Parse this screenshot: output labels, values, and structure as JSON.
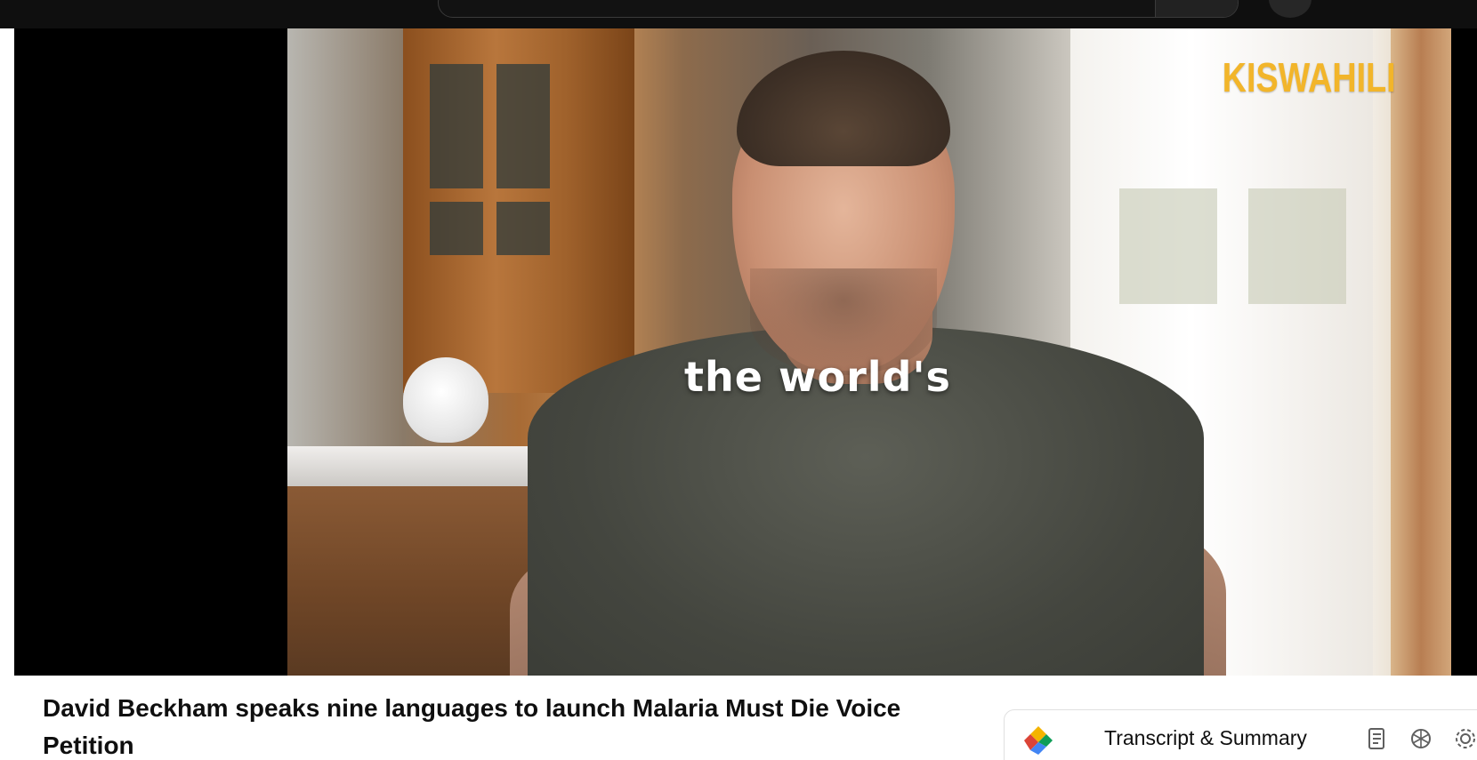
{
  "player": {
    "watermark": "KISWAHILI",
    "caption": "the world's"
  },
  "video": {
    "title": "David Beckham speaks nine languages to launch Malaria Must Die Voice Petition"
  },
  "transcript_panel": {
    "title": "Transcript & Summary",
    "icons": [
      "transcript-icon",
      "openai-icon",
      "settings-icon"
    ]
  },
  "colors": {
    "watermark": "#f2b52a",
    "masthead": "#0f0f0f",
    "player_bg": "#000000"
  }
}
